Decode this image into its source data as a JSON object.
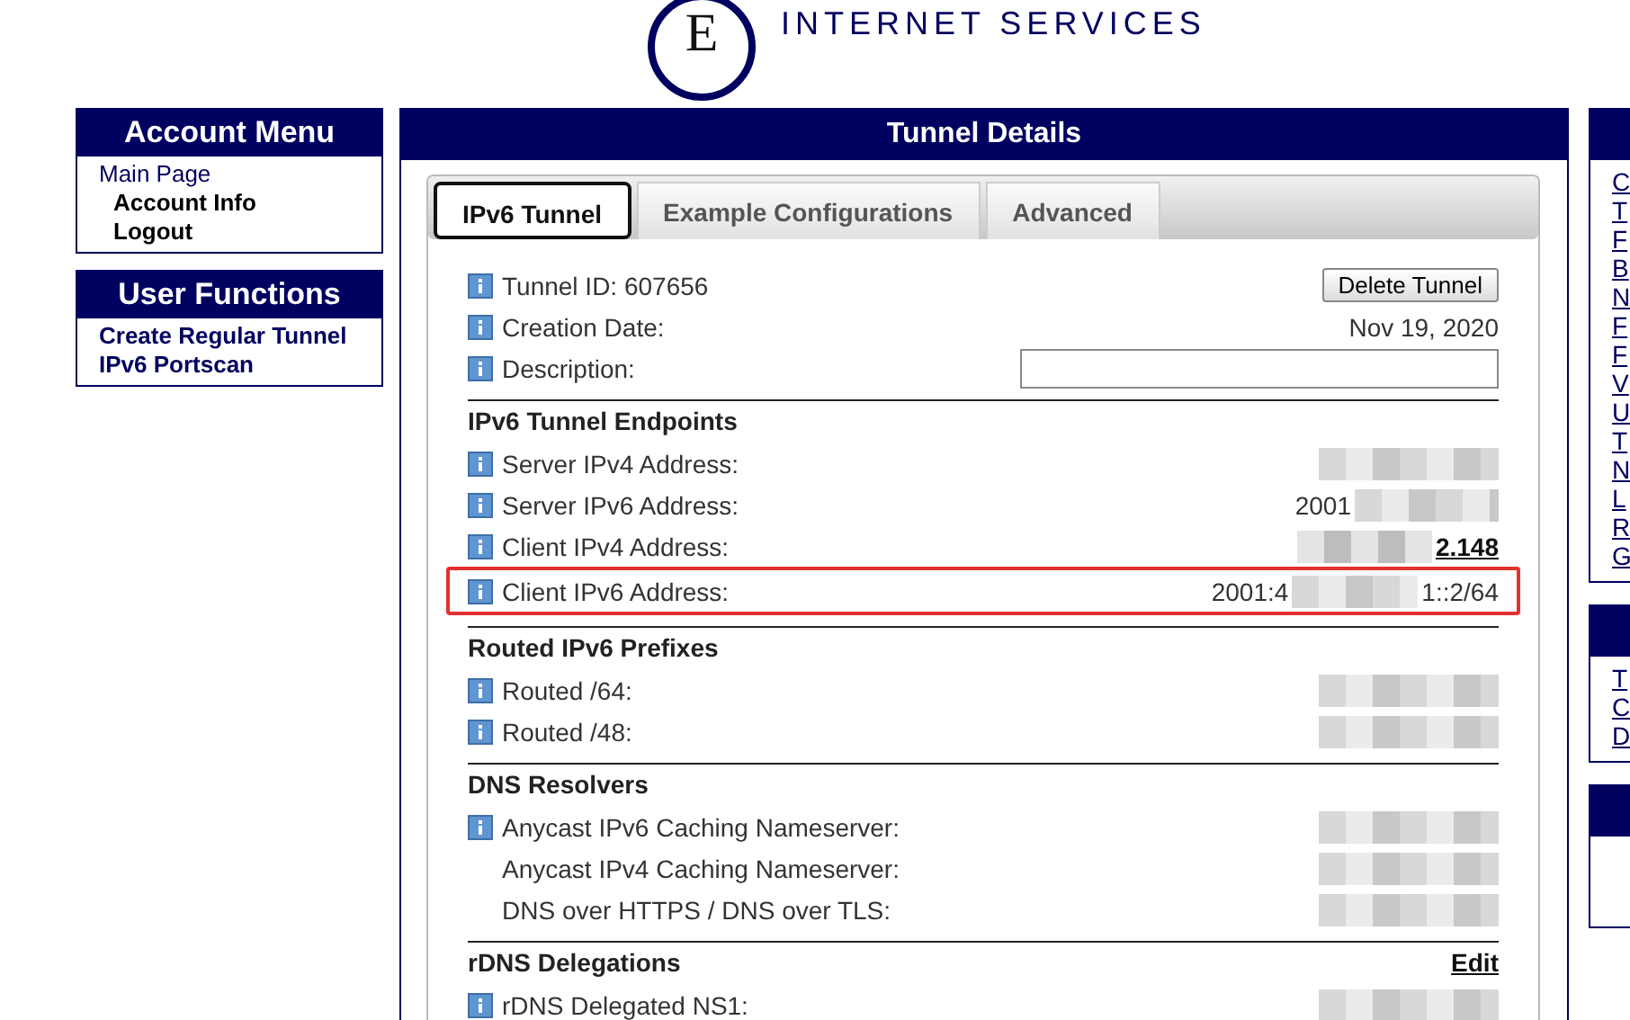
{
  "header": {
    "logo_letter": "E",
    "logo_text": "INTERNET SERVICES"
  },
  "account_menu": {
    "title": "Account Menu",
    "items": [
      {
        "label": "Main Page",
        "indent": false
      },
      {
        "label": "Account Info",
        "indent": true
      },
      {
        "label": "Logout",
        "indent": true
      }
    ]
  },
  "user_functions": {
    "title": "User Functions",
    "items": [
      "Create Regular Tunnel",
      "IPv6 Portscan"
    ]
  },
  "tunnel_details": {
    "title": "Tunnel Details",
    "tabs": [
      {
        "label": "IPv6 Tunnel",
        "selected": true
      },
      {
        "label": "Example Configurations",
        "selected": false
      },
      {
        "label": "Advanced",
        "selected": false
      }
    ],
    "general": [
      {
        "kind": "button",
        "label": "Tunnel ID: 607656",
        "value": "Delete Tunnel"
      },
      {
        "kind": "text",
        "label": "Creation Date:",
        "value": "Nov 19, 2020"
      },
      {
        "kind": "input",
        "label": "Description:"
      }
    ],
    "sections": [
      {
        "title": "IPv6 Tunnel Endpoints",
        "rows": [
          {
            "label": "Server IPv4 Address:",
            "info": true
          },
          {
            "label": "Server IPv6 Address:",
            "info": true,
            "value": "2001"
          },
          {
            "label": "Client IPv4 Address:",
            "info": true,
            "value": "2.148",
            "link": true
          },
          {
            "label": "Client IPv6 Address:",
            "info": true,
            "value": "2001:4",
            "value_end": "1::2/64",
            "highlighted": true
          }
        ]
      },
      {
        "title": "Routed IPv6 Prefixes",
        "rows": [
          {
            "label": "Routed /64:",
            "info": true
          },
          {
            "label": "Routed /48:",
            "info": true
          }
        ]
      },
      {
        "title": "DNS Resolvers",
        "rows": [
          {
            "label": "Anycast IPv6 Caching Nameserver:",
            "info": true
          },
          {
            "label": "Anycast IPv4 Caching Nameserver:",
            "info": false
          },
          {
            "label": "DNS over HTTPS / DNS over TLS:",
            "info": false
          }
        ]
      },
      {
        "title": "rDNS Delegations",
        "action": "Edit",
        "rows": [
          {
            "label": "rDNS Delegated NS1:",
            "info": true
          }
        ]
      }
    ]
  },
  "right_panels": [
    {
      "links": [
        "C",
        "T",
        "F",
        "B",
        "N",
        "F",
        "F",
        "V",
        "U",
        "T",
        "N",
        "L",
        "R",
        "G"
      ]
    },
    {
      "links": [
        "T",
        "C",
        "D"
      ]
    }
  ]
}
